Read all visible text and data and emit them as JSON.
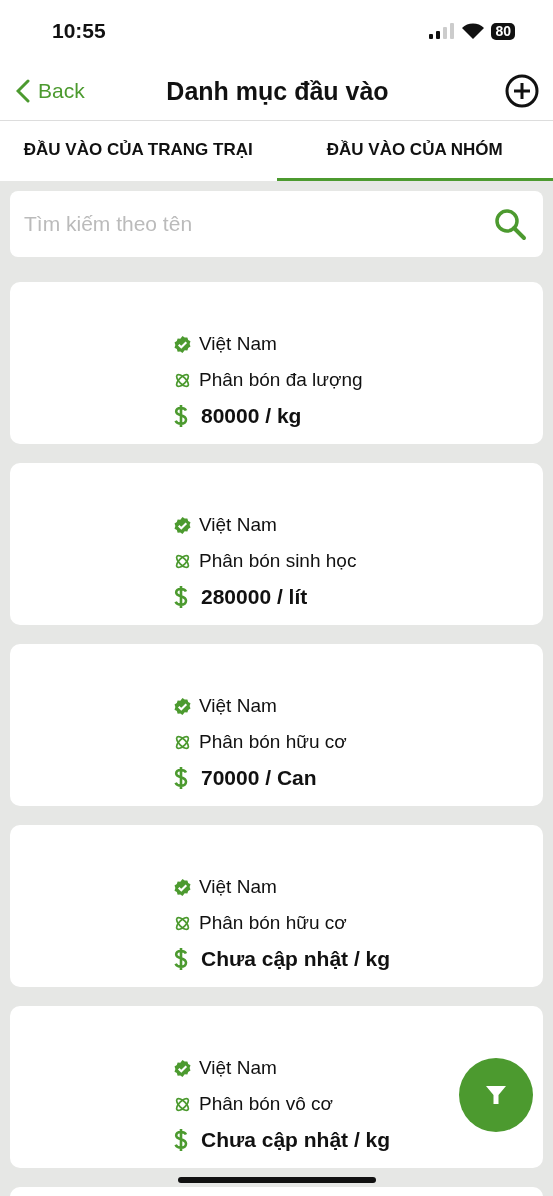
{
  "status_bar": {
    "time": "10:55",
    "battery": "80"
  },
  "header": {
    "back": "Back",
    "title": "Danh mục đầu vào"
  },
  "tabs": [
    {
      "label": "ĐẦU VÀO CỦA TRANG TRẠI",
      "selected": false
    },
    {
      "label": "ĐẦU VÀO CỦA NHÓM",
      "selected": true
    }
  ],
  "search": {
    "placeholder": "Tìm kiếm theo tên"
  },
  "items": [
    {
      "origin": "Việt Nam",
      "category": "Phân bón đa lượng",
      "price": "80000 / kg"
    },
    {
      "origin": "Việt Nam",
      "category": "Phân bón sinh học",
      "price": "280000 / lít"
    },
    {
      "origin": "Việt Nam",
      "category": "Phân bón hữu cơ",
      "price": "70000 / Can"
    },
    {
      "origin": "Việt Nam",
      "category": "Phân bón hữu cơ",
      "price": "Chưa cập nhật / kg"
    },
    {
      "origin": "Việt Nam",
      "category": "Phân bón vô cơ",
      "price": "Chưa cập nhật / kg"
    }
  ]
}
